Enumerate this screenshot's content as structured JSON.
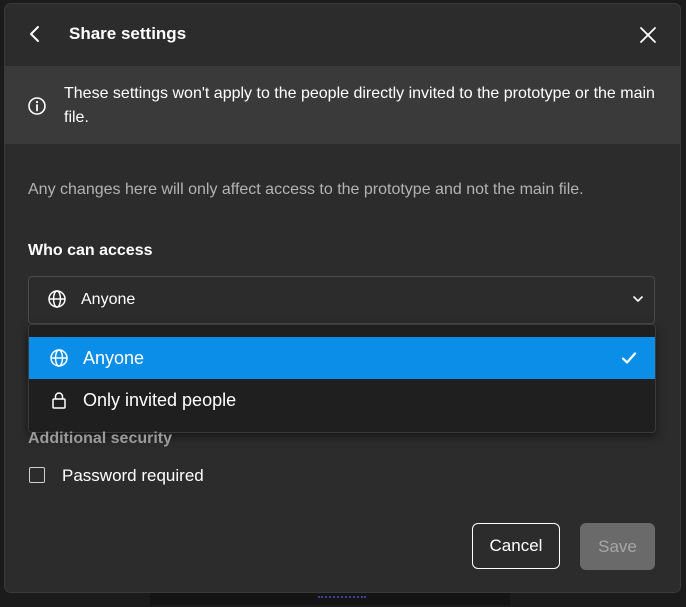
{
  "dialog": {
    "title": "Share settings",
    "back_icon": "chevron-left-icon",
    "close_icon": "close-icon"
  },
  "banner": {
    "icon": "info-icon",
    "text": "These settings won't apply to the people directly invited to the prototype or the main file."
  },
  "note": "Any changes here will only affect access to the prototype and not the main file.",
  "access": {
    "label": "Who can access",
    "selected_value": "Anyone",
    "selected_icon": "globe-icon",
    "options": [
      {
        "label": "Anyone",
        "icon": "globe-icon",
        "selected": true
      },
      {
        "label": "Only invited people",
        "icon": "lock-icon",
        "selected": false
      }
    ]
  },
  "security": {
    "label": "Additional security",
    "password_label": "Password required",
    "password_checked": false
  },
  "footer": {
    "cancel_label": "Cancel",
    "save_label": "Save"
  },
  "colors": {
    "accent": "#0b8ee8",
    "dialog_bg": "#2c2c2c",
    "banner_bg": "#3a3a3a"
  }
}
